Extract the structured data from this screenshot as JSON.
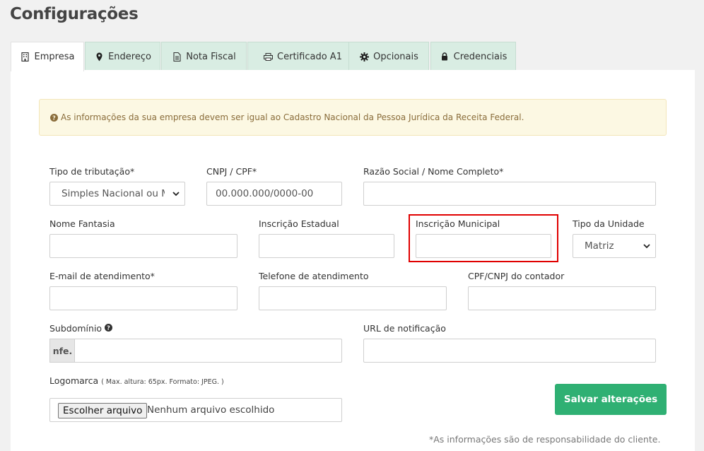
{
  "page": {
    "title": "Configurações"
  },
  "tabs": [
    {
      "label": "Empresa",
      "icon": "building-icon",
      "active": true
    },
    {
      "label": "Endereço",
      "icon": "map-marker-icon",
      "active": false
    },
    {
      "label": "Nota Fiscal",
      "icon": "document-icon",
      "active": false
    },
    {
      "label": "Certificado A1",
      "icon": "printer-icon",
      "active": false
    },
    {
      "label": "Opcionais",
      "icon": "gear-icon",
      "active": false
    },
    {
      "label": "Credenciais",
      "icon": "lock-icon",
      "active": false
    }
  ],
  "alert": {
    "text": "As informações da sua empresa devem ser igual ao Cadastro Nacional da Pessoa Jurídica da Receita Federal."
  },
  "form": {
    "tipo_tributacao": {
      "label": "Tipo de tributação*",
      "value": "Simples Nacional ou MEI"
    },
    "cnpj_cpf": {
      "label": "CNPJ / CPF*",
      "placeholder": "00.000.000/0000-00"
    },
    "razao_social": {
      "label": "Razão Social / Nome Completo*",
      "value": ""
    },
    "nome_fantasia": {
      "label": "Nome Fantasia",
      "value": ""
    },
    "inscricao_estadual": {
      "label": "Inscrição Estadual",
      "value": ""
    },
    "inscricao_municipal": {
      "label": "Inscrição Municipal",
      "value": ""
    },
    "tipo_unidade": {
      "label": "Tipo da Unidade",
      "value": "Matriz"
    },
    "email_atendimento": {
      "label": "E-mail de atendimento*",
      "value": ""
    },
    "telefone_atendimento": {
      "label": "Telefone de atendimento",
      "value": ""
    },
    "cpf_cnpj_contador": {
      "label": "CPF/CNPJ do contador",
      "value": ""
    },
    "subdominio": {
      "label": "Subdomínio",
      "prefix": "nfe.",
      "value": ""
    },
    "url_notificacao": {
      "label": "URL de notificação",
      "value": ""
    },
    "logomarca": {
      "label": "Logomarca",
      "hint": "( Max. altura: 65px. Formato: JPEG. )",
      "button": "Escolher arquivo",
      "status": "Nenhum arquivo escolhido"
    }
  },
  "actions": {
    "save_label": "Salvar alterações"
  },
  "footnote": "*As informações são de responsabilidade do cliente.",
  "colors": {
    "primary": "#2fb073",
    "tab_bg": "#d9ede3",
    "alert_bg": "#fcf8e3",
    "alert_text": "#8a6d3b",
    "highlight": "#e00000"
  }
}
